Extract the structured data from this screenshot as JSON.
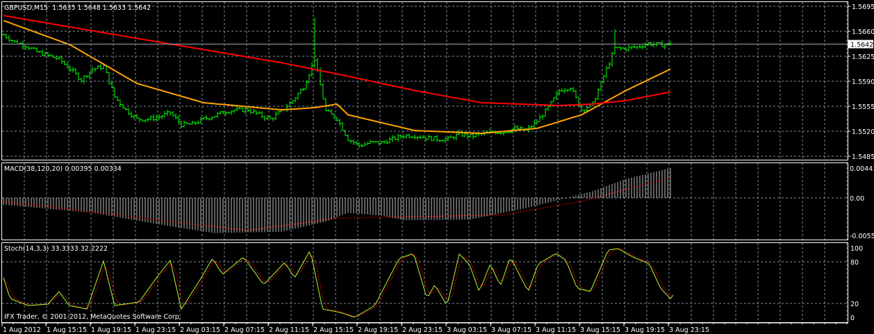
{
  "chart_data": [
    {
      "type": "bar",
      "title": "GBPUSD,M15  1.5635 1.5648 1.5633 1.5642",
      "symbol": "GBPUSD,M15",
      "ohlc_last": {
        "open": "1.5635",
        "high": "1.5648",
        "low": "1.5633",
        "close": "1.5642"
      },
      "current_price": "1.5642",
      "ylim": [
        1.5485,
        1.5695
      ],
      "y_ticks": [
        "1.5695",
        "1.5660",
        "1.5625",
        "1.5590",
        "1.5555",
        "1.5520",
        "1.5485"
      ],
      "hourly_close": [
        1.5655,
        1.5645,
        1.564,
        1.5631,
        1.5626,
        1.5621,
        1.5607,
        1.5592,
        1.5607,
        1.5611,
        1.5568,
        1.555,
        1.5537,
        1.5537,
        1.554,
        1.5546,
        1.5529,
        1.553,
        1.5537,
        1.5542,
        1.5548,
        1.555,
        1.555,
        1.5543,
        1.5537,
        1.5548,
        1.5563,
        1.5582,
        1.5621,
        1.5548,
        1.5538,
        1.5509,
        1.55,
        1.5504,
        1.5504,
        1.5509,
        1.5514,
        1.5514,
        1.5511,
        1.5509,
        1.5509,
        1.5516,
        1.5513,
        1.5516,
        1.5519,
        1.5519,
        1.5524,
        1.5521,
        1.5534,
        1.5553,
        1.5577,
        1.5582,
        1.555,
        1.5558,
        1.5597,
        1.5636,
        1.5636,
        1.5638,
        1.5643,
        1.5641,
        1.5642
      ],
      "notable_highs": [
        {
          "hour": 28,
          "high": 1.5679
        },
        {
          "hour": 55,
          "high": 1.5663
        }
      ],
      "series": [
        {
          "name": "MA fast",
          "color": "#ffa500",
          "points": [
            [
              0,
              1.5675
            ],
            [
              6,
              1.5641
            ],
            [
              12,
              1.5587
            ],
            [
              18,
              1.556
            ],
            [
              25,
              1.555
            ],
            [
              28,
              1.5553
            ],
            [
              30,
              1.5558
            ],
            [
              31,
              1.5543
            ],
            [
              37,
              1.5521
            ],
            [
              43,
              1.5517
            ],
            [
              48,
              1.5524
            ],
            [
              52,
              1.5543
            ],
            [
              56,
              1.5577
            ],
            [
              60,
              1.5607
            ]
          ]
        },
        {
          "name": "MA slow",
          "color": "#ff0000",
          "points": [
            [
              0,
              1.5682
            ],
            [
              12,
              1.565
            ],
            [
              25,
              1.5616
            ],
            [
              31,
              1.5597
            ],
            [
              37,
              1.5577
            ],
            [
              43,
              1.556
            ],
            [
              50,
              1.5556
            ],
            [
              53,
              1.5558
            ],
            [
              56,
              1.5563
            ],
            [
              60,
              1.5575
            ]
          ]
        }
      ]
    },
    {
      "type": "bar",
      "title": "MACD(38,120,20) 0.00395 0.00334",
      "ylim": [
        -0.00555,
        0.00441
      ],
      "y_ticks": [
        "0.00441",
        "0.00",
        "-0.00555"
      ],
      "histogram_points": [
        [
          0,
          -0.001
        ],
        [
          8,
          -0.0022
        ],
        [
          15,
          -0.0042
        ],
        [
          19,
          -0.0052
        ],
        [
          25,
          -0.005
        ],
        [
          29,
          -0.0035
        ],
        [
          31,
          -0.0022
        ],
        [
          34,
          -0.0026
        ],
        [
          36,
          -0.0033
        ],
        [
          42,
          -0.0032
        ],
        [
          47,
          -0.0015
        ],
        [
          50,
          -0.0003
        ],
        [
          53,
          0.001
        ],
        [
          56,
          0.0028
        ],
        [
          60,
          0.0044
        ]
      ],
      "signal_points": [
        [
          0,
          -0.0005
        ],
        [
          15,
          -0.0035
        ],
        [
          22,
          -0.0048
        ],
        [
          30,
          -0.003
        ],
        [
          36,
          -0.0028
        ],
        [
          45,
          -0.0025
        ],
        [
          52,
          -0.0005
        ],
        [
          60,
          0.003
        ]
      ],
      "hist_color": "#c0c0c0",
      "signal_color": "#ff0000"
    },
    {
      "type": "line",
      "title": "Stoch(14,3,3) 33.3333 32.2222",
      "ylim": [
        0,
        100
      ],
      "y_ticks": [
        "100",
        "80",
        "20",
        "0"
      ],
      "main_points": [
        [
          0,
          57
        ],
        [
          0.6,
          27
        ],
        [
          2.2,
          17
        ],
        [
          4,
          19
        ],
        [
          5,
          37
        ],
        [
          5.9,
          17
        ],
        [
          7.5,
          12
        ],
        [
          9,
          81
        ],
        [
          10,
          17
        ],
        [
          12.2,
          22
        ],
        [
          14,
          62
        ],
        [
          15,
          82
        ],
        [
          16,
          12
        ],
        [
          17.8,
          57
        ],
        [
          18.8,
          85
        ],
        [
          19.7,
          62
        ],
        [
          21.6,
          87
        ],
        [
          23.4,
          47
        ],
        [
          25.3,
          79
        ],
        [
          26.2,
          57
        ],
        [
          27.6,
          97
        ],
        [
          28.7,
          12
        ],
        [
          30.3,
          7
        ],
        [
          31.6,
          0
        ],
        [
          33.4,
          17
        ],
        [
          35.6,
          85
        ],
        [
          36.9,
          92
        ],
        [
          38.1,
          27
        ],
        [
          38.8,
          47
        ],
        [
          39.9,
          17
        ],
        [
          41,
          91
        ],
        [
          41.9,
          77
        ],
        [
          42.8,
          37
        ],
        [
          43.8,
          77
        ],
        [
          44.7,
          45
        ],
        [
          45.6,
          87
        ],
        [
          47.2,
          37
        ],
        [
          48.1,
          77
        ],
        [
          49.7,
          92
        ],
        [
          50.6,
          82
        ],
        [
          51.6,
          42
        ],
        [
          52.8,
          37
        ],
        [
          54.4,
          97
        ],
        [
          55.3,
          99
        ],
        [
          56.6,
          87
        ],
        [
          58.1,
          77
        ],
        [
          59.1,
          42
        ],
        [
          60,
          27
        ],
        [
          60.3,
          33
        ]
      ],
      "main_color": "#adff2f",
      "signal_color": "#ff0000"
    }
  ],
  "x_axis": {
    "labels": [
      "1 Aug 2012",
      "1 Aug 15:15",
      "1 Aug 19:15",
      "1 Aug 23:15",
      "2 Aug 03:15",
      "2 Aug 07:15",
      "2 Aug 11:15",
      "2 Aug 15:15",
      "2 Aug 19:15",
      "2 Aug 23:15",
      "3 Aug 03:15",
      "3 Aug 07:15",
      "3 Aug 11:15",
      "3 Aug 15:15",
      "3 Aug 19:15",
      "3 Aug 23:15"
    ]
  },
  "footer": {
    "copyright": "IFX Trader, © 2001-2012, MetaQuotes Software Corp."
  },
  "colors": {
    "bars": "#00ff00",
    "grid": "#7f8f9f",
    "frame": "#ffffff",
    "background": "#000000"
  }
}
